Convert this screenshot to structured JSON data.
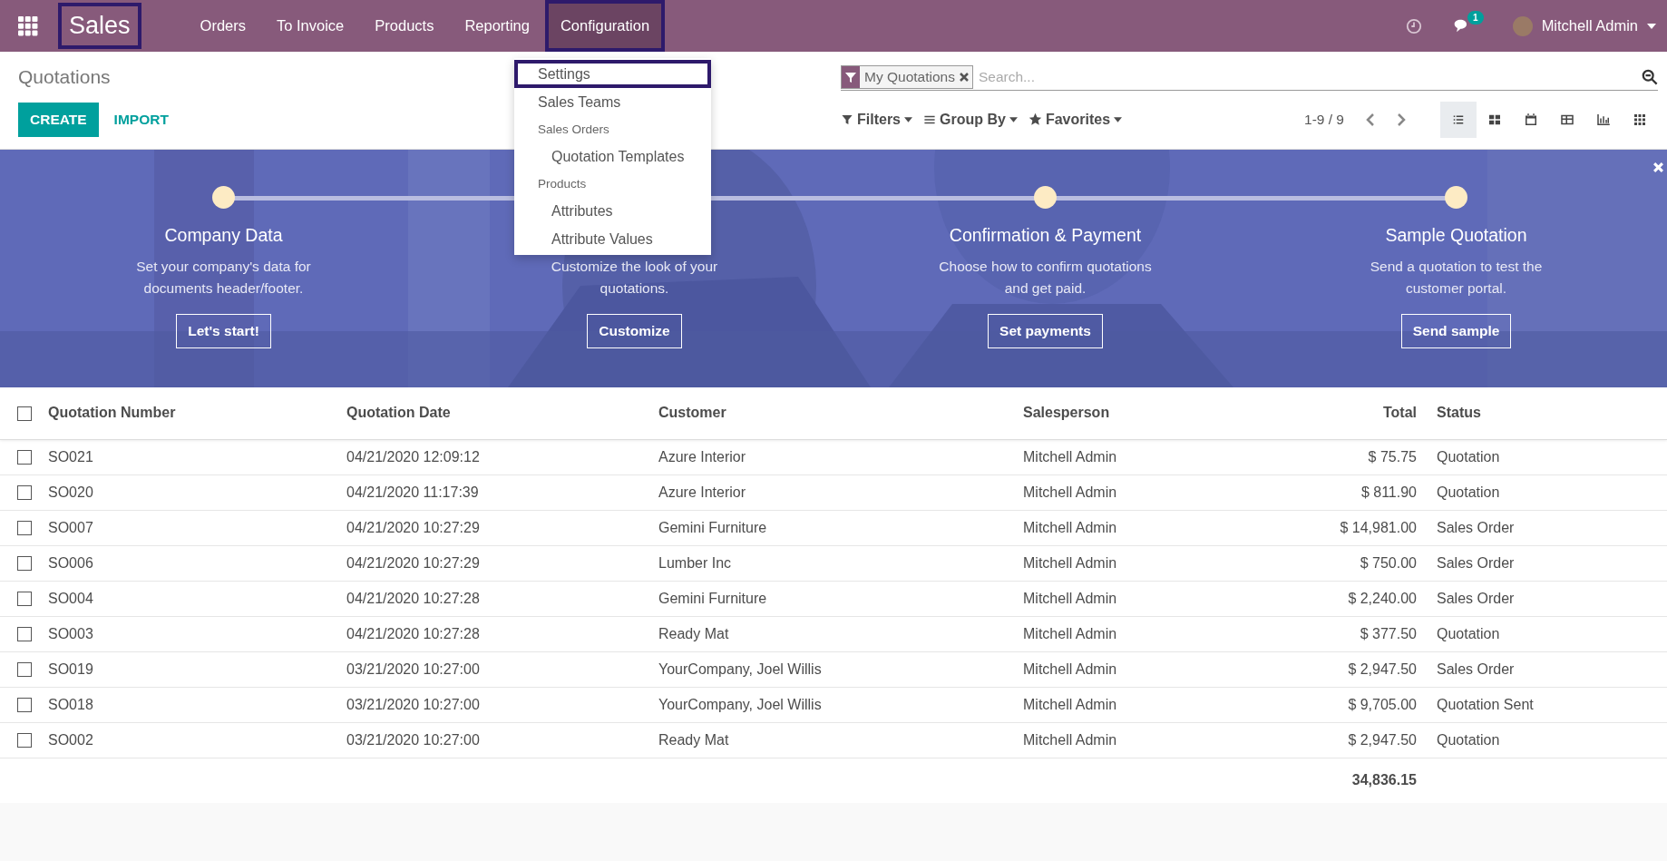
{
  "navbar": {
    "brand": {
      "label": "Sales",
      "highlighted": true
    },
    "menu": [
      {
        "label": "Orders",
        "selected": false,
        "highlighted": false
      },
      {
        "label": "To Invoice",
        "selected": false,
        "highlighted": false
      },
      {
        "label": "Products",
        "selected": false,
        "highlighted": false
      },
      {
        "label": "Reporting",
        "selected": false,
        "highlighted": false
      },
      {
        "label": "Configuration",
        "selected": true,
        "highlighted": true
      }
    ],
    "messages_badge": "1",
    "user": "Mitchell Admin"
  },
  "dropdown": [
    {
      "kind": "item",
      "label": "Settings",
      "highlighted": true
    },
    {
      "kind": "item",
      "label": "Sales Teams",
      "highlighted": false
    },
    {
      "kind": "header",
      "label": "Sales Orders",
      "children": [
        {
          "label": "Quotation Templates",
          "highlighted": false
        }
      ]
    },
    {
      "kind": "header",
      "label": "Products",
      "children": [
        {
          "label": "Attributes",
          "highlighted": false
        },
        {
          "label": "Attribute Values",
          "highlighted": false
        }
      ]
    }
  ],
  "control_panel": {
    "title": "Quotations",
    "buttons": [
      "CREATE",
      "IMPORT"
    ],
    "search": {
      "facet": "My Quotations",
      "placeholder": "Search..."
    },
    "filters": [
      "Filters",
      "Group By",
      "Favorites"
    ],
    "pager": "1-9 / 9",
    "views": [
      {
        "kind": "list",
        "selected": true
      },
      {
        "kind": "kanban",
        "selected": false
      },
      {
        "kind": "calendar",
        "selected": false
      },
      {
        "kind": "pivot",
        "selected": false
      },
      {
        "kind": "graph",
        "selected": false
      },
      {
        "kind": "activity",
        "selected": false
      }
    ]
  },
  "onboarding": {
    "steps": [
      {
        "dot": true,
        "title": "Company Data",
        "description": "Set your company's data for documents header/footer.",
        "button": "Let's start!"
      },
      {
        "dot": false,
        "description": "Customize the look of your quotations.",
        "button": "Customize"
      },
      {
        "dot": true,
        "title": "Confirmation & Payment",
        "description": "Choose how to confirm quotations and get paid.",
        "button": "Set payments"
      },
      {
        "dot": true,
        "title": "Sample Quotation",
        "description": "Send a quotation to test the customer portal.",
        "button": "Send sample"
      }
    ]
  },
  "table": {
    "select_all_checked": false,
    "columns": [
      "Quotation Number",
      "Quotation Date",
      "Customer",
      "Salesperson",
      "Total",
      "Status"
    ],
    "rows": [
      {
        "checked": false,
        "cells": [
          "SO021",
          "04/21/2020 12:09:12",
          "Azure Interior",
          "Mitchell Admin",
          "$ 75.75",
          "Quotation"
        ]
      },
      {
        "checked": false,
        "cells": [
          "SO020",
          "04/21/2020 11:17:39",
          "Azure Interior",
          "Mitchell Admin",
          "$ 811.90",
          "Quotation"
        ]
      },
      {
        "checked": false,
        "cells": [
          "SO007",
          "04/21/2020 10:27:29",
          "Gemini Furniture",
          "Mitchell Admin",
          "$ 14,981.00",
          "Sales Order"
        ]
      },
      {
        "checked": false,
        "cells": [
          "SO006",
          "04/21/2020 10:27:29",
          "Lumber Inc",
          "Mitchell Admin",
          "$ 750.00",
          "Sales Order"
        ]
      },
      {
        "checked": false,
        "cells": [
          "SO004",
          "04/21/2020 10:27:28",
          "Gemini Furniture",
          "Mitchell Admin",
          "$ 2,240.00",
          "Sales Order"
        ]
      },
      {
        "checked": false,
        "cells": [
          "SO003",
          "04/21/2020 10:27:28",
          "Ready Mat",
          "Mitchell Admin",
          "$ 377.50",
          "Quotation"
        ]
      },
      {
        "checked": false,
        "cells": [
          "SO019",
          "03/21/2020 10:27:00",
          "YourCompany, Joel Willis",
          "Mitchell Admin",
          "$ 2,947.50",
          "Sales Order"
        ]
      },
      {
        "checked": false,
        "cells": [
          "SO018",
          "03/21/2020 10:27:00",
          "YourCompany, Joel Willis",
          "Mitchell Admin",
          "$ 9,705.00",
          "Quotation Sent"
        ]
      },
      {
        "checked": false,
        "cells": [
          "SO002",
          "03/21/2020 10:27:00",
          "Ready Mat",
          "Mitchell Admin",
          "$ 2,947.50",
          "Quotation"
        ]
      }
    ],
    "total": "34,836.15"
  }
}
